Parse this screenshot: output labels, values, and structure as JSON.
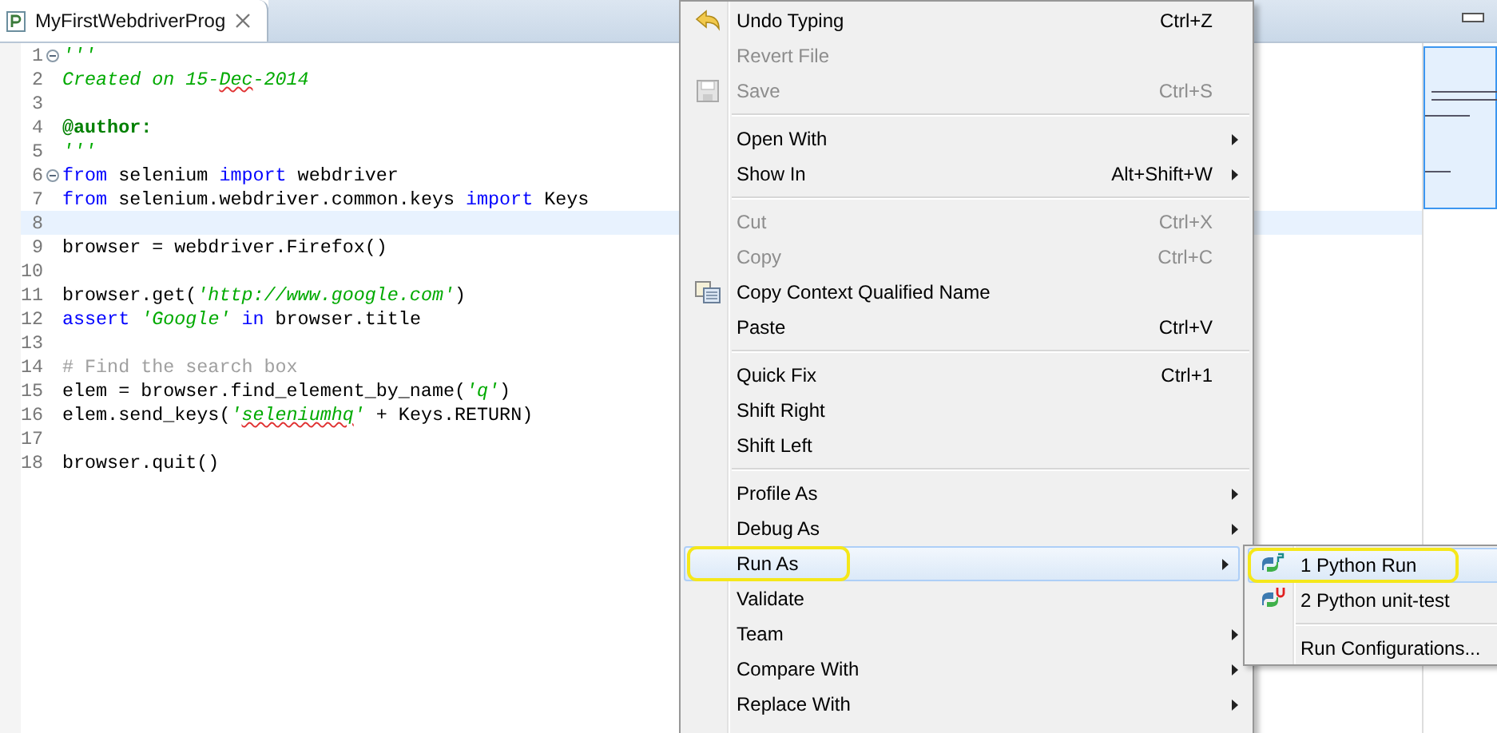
{
  "editor_tab": {
    "title": "MyFirstWebdriverProg"
  },
  "code_lines": [
    {
      "number": "1",
      "fold_marker": true,
      "current": false,
      "tokens": [
        {
          "kind": "doc",
          "text": "'''"
        }
      ]
    },
    {
      "number": "2",
      "fold_marker": false,
      "current": false,
      "tokens": [
        {
          "kind": "doc",
          "text": "Created on 15-"
        },
        {
          "kind": "doc",
          "text": "Dec",
          "misspelled": true
        },
        {
          "kind": "doc",
          "text": "-2014"
        }
      ]
    },
    {
      "number": "3",
      "fold_marker": false,
      "current": false
    },
    {
      "number": "4",
      "fold_marker": false,
      "current": false,
      "tokens": [
        {
          "kind": "decorator",
          "text": "@author:"
        }
      ]
    },
    {
      "number": "5",
      "fold_marker": false,
      "current": false,
      "tokens": [
        {
          "kind": "doc",
          "text": "'''"
        }
      ]
    },
    {
      "number": "6",
      "fold_marker": true,
      "current": false,
      "tokens": [
        {
          "kind": "keyword",
          "text": "from"
        },
        {
          "kind": "plain",
          "text": " selenium "
        },
        {
          "kind": "keyword",
          "text": "import"
        },
        {
          "kind": "plain",
          "text": " webdriver"
        }
      ]
    },
    {
      "number": "7",
      "fold_marker": false,
      "current": false,
      "tokens": [
        {
          "kind": "keyword",
          "text": "from"
        },
        {
          "kind": "plain",
          "text": " selenium.webdriver.common.keys "
        },
        {
          "kind": "keyword",
          "text": "import"
        },
        {
          "kind": "plain",
          "text": " Keys"
        }
      ]
    },
    {
      "number": "8",
      "fold_marker": false,
      "current": true
    },
    {
      "number": "9",
      "fold_marker": false,
      "current": false,
      "tokens": [
        {
          "kind": "plain",
          "text": "browser = webdriver.Firefox()"
        }
      ]
    },
    {
      "number": "10",
      "fold_marker": false,
      "current": false
    },
    {
      "number": "11",
      "fold_marker": false,
      "current": false,
      "tokens": [
        {
          "kind": "plain",
          "text": "browser.get("
        },
        {
          "kind": "string",
          "text": "'http://www.google.com'"
        },
        {
          "kind": "plain",
          "text": ")"
        }
      ]
    },
    {
      "number": "12",
      "fold_marker": false,
      "current": false,
      "tokens": [
        {
          "kind": "keyword",
          "text": "assert "
        },
        {
          "kind": "string",
          "text": "'Google'"
        },
        {
          "kind": "keyword",
          "text": " in"
        },
        {
          "kind": "plain",
          "text": " browser.title"
        }
      ]
    },
    {
      "number": "13",
      "fold_marker": false,
      "current": false
    },
    {
      "number": "14",
      "fold_marker": false,
      "current": false,
      "tokens": [
        {
          "kind": "comment",
          "text": "# Find the search box"
        }
      ]
    },
    {
      "number": "15",
      "fold_marker": false,
      "current": false,
      "tokens": [
        {
          "kind": "plain",
          "text": "elem = browser.find_element_by_name("
        },
        {
          "kind": "string",
          "text": "'q'"
        },
        {
          "kind": "plain",
          "text": ")"
        }
      ]
    },
    {
      "number": "16",
      "fold_marker": false,
      "current": false,
      "tokens": [
        {
          "kind": "plain",
          "text": "elem.send_keys("
        },
        {
          "kind": "string",
          "text": "'"
        },
        {
          "kind": "string",
          "text": "seleniumhq",
          "misspelled": true
        },
        {
          "kind": "string",
          "text": "'"
        },
        {
          "kind": "plain",
          "text": " + Keys.RETURN)"
        }
      ]
    },
    {
      "number": "17",
      "fold_marker": false,
      "current": false
    },
    {
      "number": "18",
      "fold_marker": false,
      "current": false,
      "tokens": [
        {
          "kind": "plain",
          "text": "browser.quit()"
        }
      ]
    }
  ],
  "context_menu": [
    {
      "kind": "undo",
      "label": "Undo Typing",
      "shortcut": "Ctrl+Z",
      "disabled": false,
      "submenu": false,
      "selected": false,
      "circled": false
    },
    {
      "kind": "item",
      "label": "Revert File",
      "disabled": true,
      "submenu": false,
      "selected": false,
      "circled": false
    },
    {
      "kind": "save",
      "label": "Save",
      "shortcut": "Ctrl+S",
      "disabled": true,
      "submenu": false,
      "selected": false,
      "circled": false
    },
    {
      "kind": "separator"
    },
    {
      "kind": "item",
      "label": "Open With",
      "disabled": false,
      "submenu": true,
      "selected": false,
      "circled": false
    },
    {
      "kind": "item",
      "label": "Show In",
      "shortcut": "Alt+Shift+W",
      "disabled": false,
      "submenu": true,
      "selected": false,
      "circled": false
    },
    {
      "kind": "separator"
    },
    {
      "kind": "item",
      "label": "Cut",
      "shortcut": "Ctrl+X",
      "disabled": true,
      "submenu": false,
      "selected": false,
      "circled": false
    },
    {
      "kind": "item",
      "label": "Copy",
      "shortcut": "Ctrl+C",
      "disabled": true,
      "submenu": false,
      "selected": false,
      "circled": false
    },
    {
      "kind": "copy",
      "label": "Copy Context Qualified Name",
      "disabled": false,
      "submenu": false,
      "selected": false,
      "circled": false
    },
    {
      "kind": "item",
      "label": "Paste",
      "shortcut": "Ctrl+V",
      "disabled": false,
      "submenu": false,
      "selected": false,
      "circled": false
    },
    {
      "kind": "separator"
    },
    {
      "kind": "item",
      "label": "Quick Fix",
      "shortcut": "Ctrl+1",
      "disabled": false,
      "submenu": false,
      "selected": false,
      "circled": false
    },
    {
      "kind": "item",
      "label": "Shift Right",
      "disabled": false,
      "submenu": false,
      "selected": false,
      "circled": false
    },
    {
      "kind": "item",
      "label": "Shift Left",
      "disabled": false,
      "submenu": false,
      "selected": false,
      "circled": false
    },
    {
      "kind": "separator"
    },
    {
      "kind": "item",
      "label": "Profile As",
      "disabled": false,
      "submenu": true,
      "selected": false,
      "circled": false
    },
    {
      "kind": "item",
      "label": "Debug As",
      "disabled": false,
      "submenu": true,
      "selected": false,
      "circled": false
    },
    {
      "kind": "item",
      "label": "Run As",
      "disabled": false,
      "submenu": true,
      "selected": true,
      "circled": true
    },
    {
      "kind": "item",
      "label": "Validate",
      "disabled": false,
      "submenu": false,
      "selected": false,
      "circled": false
    },
    {
      "kind": "item",
      "label": "Team",
      "disabled": false,
      "submenu": true,
      "selected": false,
      "circled": false
    },
    {
      "kind": "item",
      "label": "Compare With",
      "disabled": false,
      "submenu": true,
      "selected": false,
      "circled": false
    },
    {
      "kind": "item",
      "label": "Replace With",
      "disabled": false,
      "submenu": true,
      "selected": false,
      "circled": false
    }
  ],
  "run_as_submenu": [
    {
      "kind": "python-run",
      "label": "1 Python Run",
      "selected": true,
      "circled": true
    },
    {
      "kind": "python-test",
      "label": "2 Python unit-test",
      "selected": false,
      "circled": false
    },
    {
      "kind": "separator"
    },
    {
      "kind": "item",
      "label": "Run Configurations...",
      "selected": false,
      "circled": false
    }
  ]
}
